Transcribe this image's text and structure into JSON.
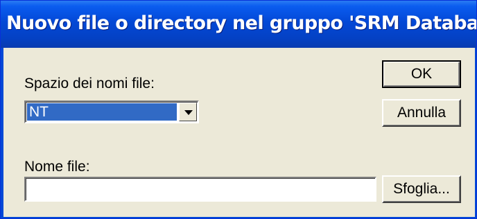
{
  "window": {
    "title": "Nuovo file o directory nel gruppo 'SRM Database Files'"
  },
  "form": {
    "namespace_label": "Spazio dei nomi file:",
    "namespace_value": "NT",
    "filename_label": "Nome file:",
    "filename_value": ""
  },
  "buttons": {
    "ok": "OK",
    "cancel": "Annulla",
    "browse": "Sfoglia..."
  },
  "colors": {
    "titlebar": "#0348d6",
    "selection": "#316ac5",
    "dialog_face": "#ece9d8"
  }
}
